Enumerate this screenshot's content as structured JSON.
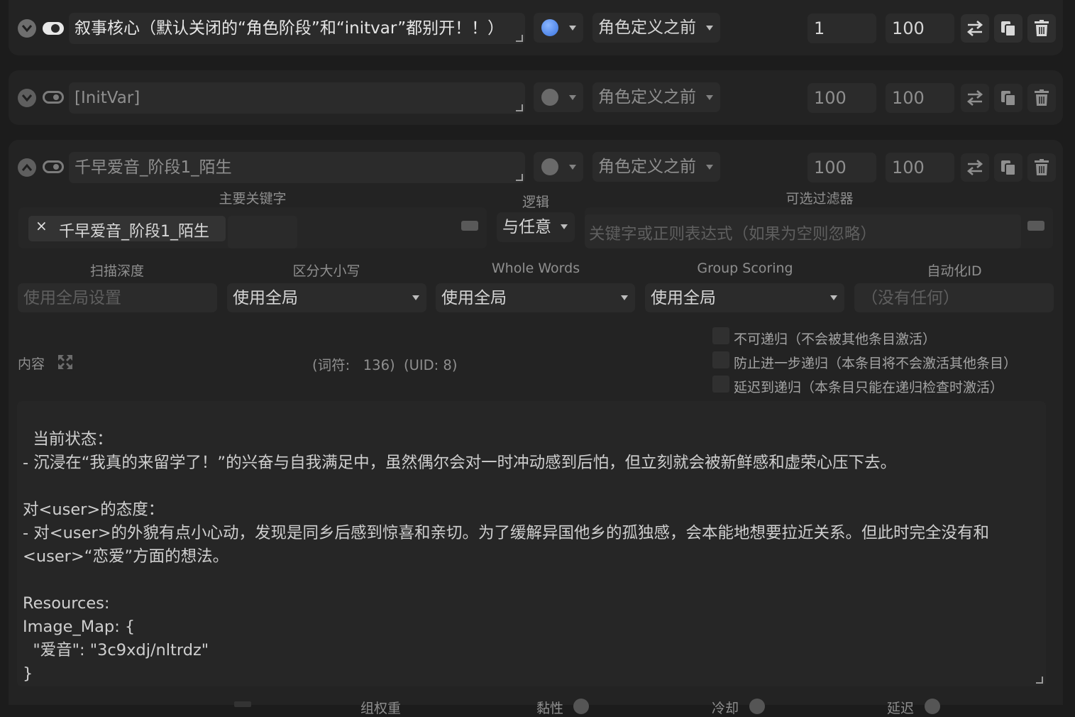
{
  "entries": [
    {
      "title": "叙事核心（默认关闭的“角色阶段”和“initvar”都别开！！）",
      "enabled": true,
      "strategy_color": "#4a8cf0",
      "position": "角色定义之前",
      "order": "1",
      "probability": "100"
    },
    {
      "title": "[InitVar]",
      "enabled": false,
      "strategy_color": "#6e6e6e",
      "position": "角色定义之前",
      "order": "100",
      "probability": "100"
    },
    {
      "title": "千早爱音_阶段1_陌生",
      "enabled": false,
      "expanded": true,
      "strategy_color": "#6e6e6e",
      "position": "角色定义之前",
      "order": "100",
      "probability": "100"
    }
  ],
  "icons": {
    "collapse": "chevron-down-icon",
    "expand": "chevron-up-icon",
    "move": "swap-arrows-icon",
    "duplicate": "copy-icon",
    "delete": "trash-icon",
    "expand_content": "fullscreen-icon"
  },
  "editor": {
    "labels": {
      "primary_keywords": "主要关键字",
      "logic": "逻辑",
      "optional_filter": "可选过滤器",
      "scan_depth": "扫描深度",
      "case_sensitive": "区分大小写",
      "whole_words": "Whole Words",
      "group_scoring": "Group Scoring",
      "automation_id": "自动化ID",
      "content": "内容"
    },
    "keyword_tag": "千早爱音_阶段1_陌生",
    "tag_remove_glyph": "×",
    "logic_value": "与任意",
    "filter_placeholder": "关键字或正则表达式（如果为空则忽略）",
    "scan_depth_placeholder": "使用全局设置",
    "case_sensitive_value": "使用全局",
    "whole_words_value": "使用全局",
    "group_scoring_value": "使用全局",
    "automation_id_placeholder": "（没有任何）",
    "token_info": "(词符:   136)  (UID: 8)",
    "checkboxes": [
      "不可递归（不会被其他条目激活）",
      "防止进一步递归（本条目将不会激活其他条目）",
      "延迟到递归（本条目只能在递归检查时激活）"
    ],
    "content_text": "当前状态：\n- 沉浸在“我真的来留学了！”的兴奋与自我满足中，虽然偶尔会对一时冲动感到后怕，但立刻就会被新鲜感和虚荣心压下去。\n\n对<user>的态度：\n- 对<user>的外貌有点小心动，发现是同乡后感到惊喜和亲切。为了缓解异国他乡的孤独感，会本能地想要拉近关系。但此时完全没有和<user>“恋爱”方面的想法。\n\nResources:\nImage_Map: {\n  \"爱音\": \"3c9xdj/nltrdz\"\n}"
  },
  "bottom_partial": [
    "组权重",
    "黏性",
    "冷却",
    "延迟"
  ]
}
